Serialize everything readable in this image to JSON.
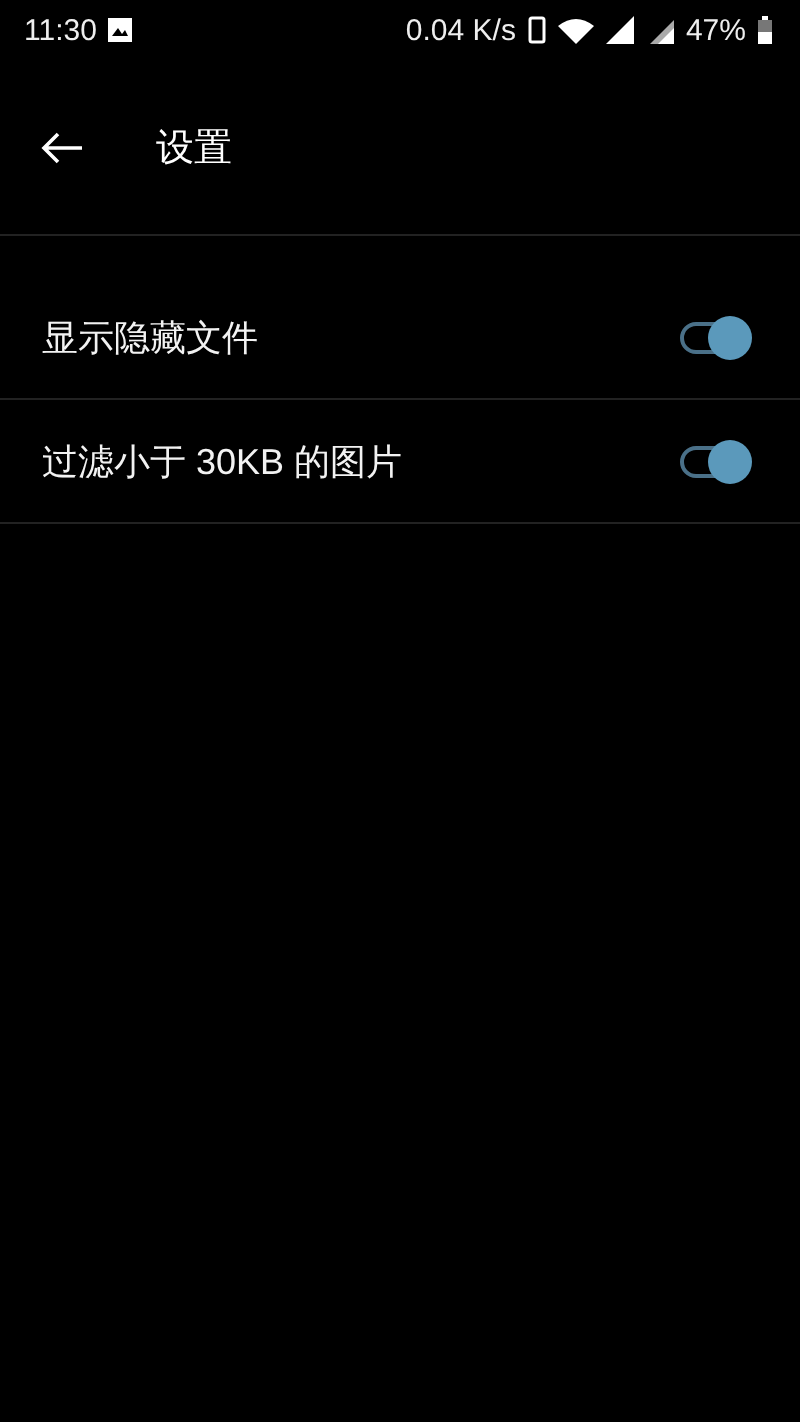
{
  "status_bar": {
    "time": "11:30",
    "speed": "0.04 K/s",
    "battery": "47%"
  },
  "toolbar": {
    "title": "设置"
  },
  "settings": [
    {
      "label": "显示隐藏文件",
      "on": true
    },
    {
      "label": "过滤小于 30KB 的图片",
      "on": true
    }
  ]
}
